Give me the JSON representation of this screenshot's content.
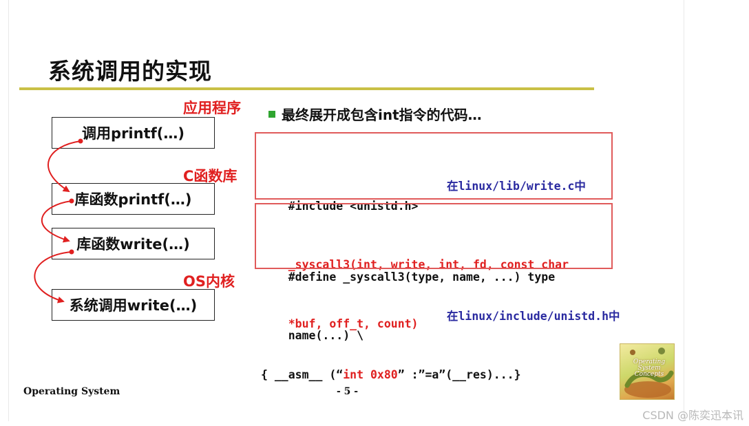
{
  "slide": {
    "title": "系统调用的实现",
    "labels": {
      "app": "应用程序",
      "clib": "C函数库",
      "kernel": "OS内核"
    },
    "flow_boxes": [
      "调用printf(…)",
      "库函数printf(…)",
      "库函数write(…)",
      "系统调用write(…)"
    ],
    "bullet": "最终展开成包含int指令的代码…",
    "code_box_1": {
      "line1": "#include <unistd.h>",
      "note1": "在linux/lib/write.c中",
      "line2": "_syscall3(int, write, int, fd, const char",
      "line3": "*buf, off_t, count)"
    },
    "code_box_2": {
      "line1": "#define _syscall3(type, name, ...) type",
      "line2": "name(...) \\",
      "note2": "在linux/include/unistd.h中",
      "line3_a": "{ __asm__ (“",
      "line3_b": "int 0x80",
      "line3_c": "” :”=a”(__res)...}"
    },
    "footer": {
      "left": "Operating System",
      "page": "- 5 -"
    },
    "book": {
      "title": "Operating System Concepts"
    }
  },
  "watermark": "CSDN @陈奕迅本讯",
  "colors": {
    "label_red": "#e02020",
    "rule_olive": "#c9c046",
    "note_blue": "#2a2aa0",
    "bullet_green": "#2fa530",
    "box_border": "#e05a5a"
  }
}
